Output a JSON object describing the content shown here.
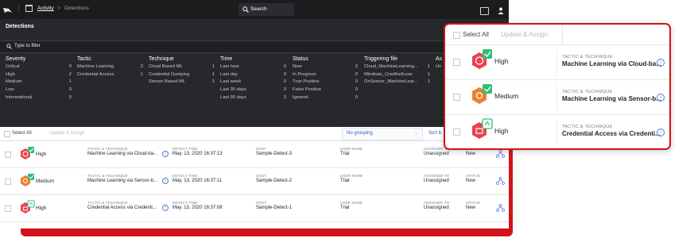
{
  "colors": {
    "accent_red": "#d0141a",
    "link_blue": "#1b63c8",
    "dark_bg": "#26282b",
    "severity_high": "#e8434f",
    "severity_medium": "#f07f2a",
    "badge_green": "#2dbf72"
  },
  "topbar": {
    "breadcrumb_activity": "Activity",
    "breadcrumb_separator": ">",
    "breadcrumb_current": "Detections",
    "search_label": "Search"
  },
  "panel": {
    "title": "Detections",
    "filter_placeholder": "Type to filter",
    "add_filter_label": "+Q",
    "columns": [
      {
        "header": "Severity",
        "items": [
          {
            "label": "Critical",
            "count": "0"
          },
          {
            "label": "High",
            "count": "2"
          },
          {
            "label": "Medium",
            "count": "1"
          },
          {
            "label": "Low",
            "count": "0"
          },
          {
            "label": "Informational",
            "count": "0"
          }
        ]
      },
      {
        "header": "Tactic",
        "items": [
          {
            "label": "Machine Learning",
            "count": "2"
          },
          {
            "label": "Credential Access",
            "count": "1"
          }
        ]
      },
      {
        "header": "Technique",
        "items": [
          {
            "label": "Cloud Based ML",
            "count": "1"
          },
          {
            "label": "Credential Dumping",
            "count": "1"
          },
          {
            "label": "Sensor Based ML",
            "count": "1"
          }
        ]
      },
      {
        "header": "Time",
        "items": [
          {
            "label": "Last hour",
            "count": "0"
          },
          {
            "label": "Last day",
            "count": "0"
          },
          {
            "label": "Last week",
            "count": "0"
          },
          {
            "label": "Last 30 days",
            "count": "3"
          },
          {
            "label": "Last 90 days",
            "count": "3"
          }
        ]
      },
      {
        "header": "Status",
        "items": [
          {
            "label": "New",
            "count": "3"
          },
          {
            "label": "In Progress",
            "count": "0"
          },
          {
            "label": "True Positive",
            "count": "0"
          },
          {
            "label": "False Positive",
            "count": "0"
          },
          {
            "label": "Ignored",
            "count": "0"
          }
        ]
      },
      {
        "header": "Triggering file",
        "items": [
          {
            "label": "Cloud_MachineLearning...",
            "count": "1"
          },
          {
            "label": "Mimikatz_Credtheft.exe",
            "count": "1"
          },
          {
            "label": "OnSensor_MachineLear...",
            "count": "1"
          }
        ]
      },
      {
        "header": "As",
        "items": [
          {
            "label": "Un",
            "count": ""
          }
        ]
      }
    ]
  },
  "list": {
    "select_all": "Select All",
    "update_assign": "Update & Assign",
    "grouping": "No grouping",
    "grouping_caret": "⌄",
    "sort_label": "Sort b",
    "labels": {
      "tactic": "TACTIC & TECHNIQUE",
      "detect_time": "DETECT TIME",
      "host": "HOST",
      "user": "USER NAME",
      "assigned": "ASSIGNED TO",
      "status": "STATUS"
    },
    "rows": [
      {
        "severity": "High",
        "tactic": "Machine Learning via Cloud-ba...",
        "time": "May. 13, 2020 16:37:13",
        "host": "Sample-Detect-3",
        "user": "Trial",
        "assigned": "Unassigned",
        "status": "New"
      },
      {
        "severity": "Medium",
        "tactic": "Machine Learning via Sensor-b...",
        "time": "May. 13, 2020 16:37:11",
        "host": "Sample-Detect-2",
        "user": "Trial",
        "assigned": "Unassigned",
        "status": "New"
      },
      {
        "severity": "High",
        "tactic": "Credential Access via Credenti...",
        "time": "May. 13, 2020 16:37:08",
        "host": "Sample-Detect-1",
        "user": "Trial",
        "assigned": "Unassigned",
        "status": "New"
      }
    ]
  },
  "callout": {
    "select_all": "Select All",
    "update_assign": "Update & Assign",
    "tactic_label": "TACTIC & TECHNIQUE",
    "rows": [
      {
        "severity": "High",
        "tactic": "Machine Learning via Cloud-ba..."
      },
      {
        "severity": "Medium",
        "tactic": "Machine Learning via Sensor-b..."
      },
      {
        "severity": "High",
        "tactic": "Credential Access via Credenti..."
      }
    ]
  }
}
